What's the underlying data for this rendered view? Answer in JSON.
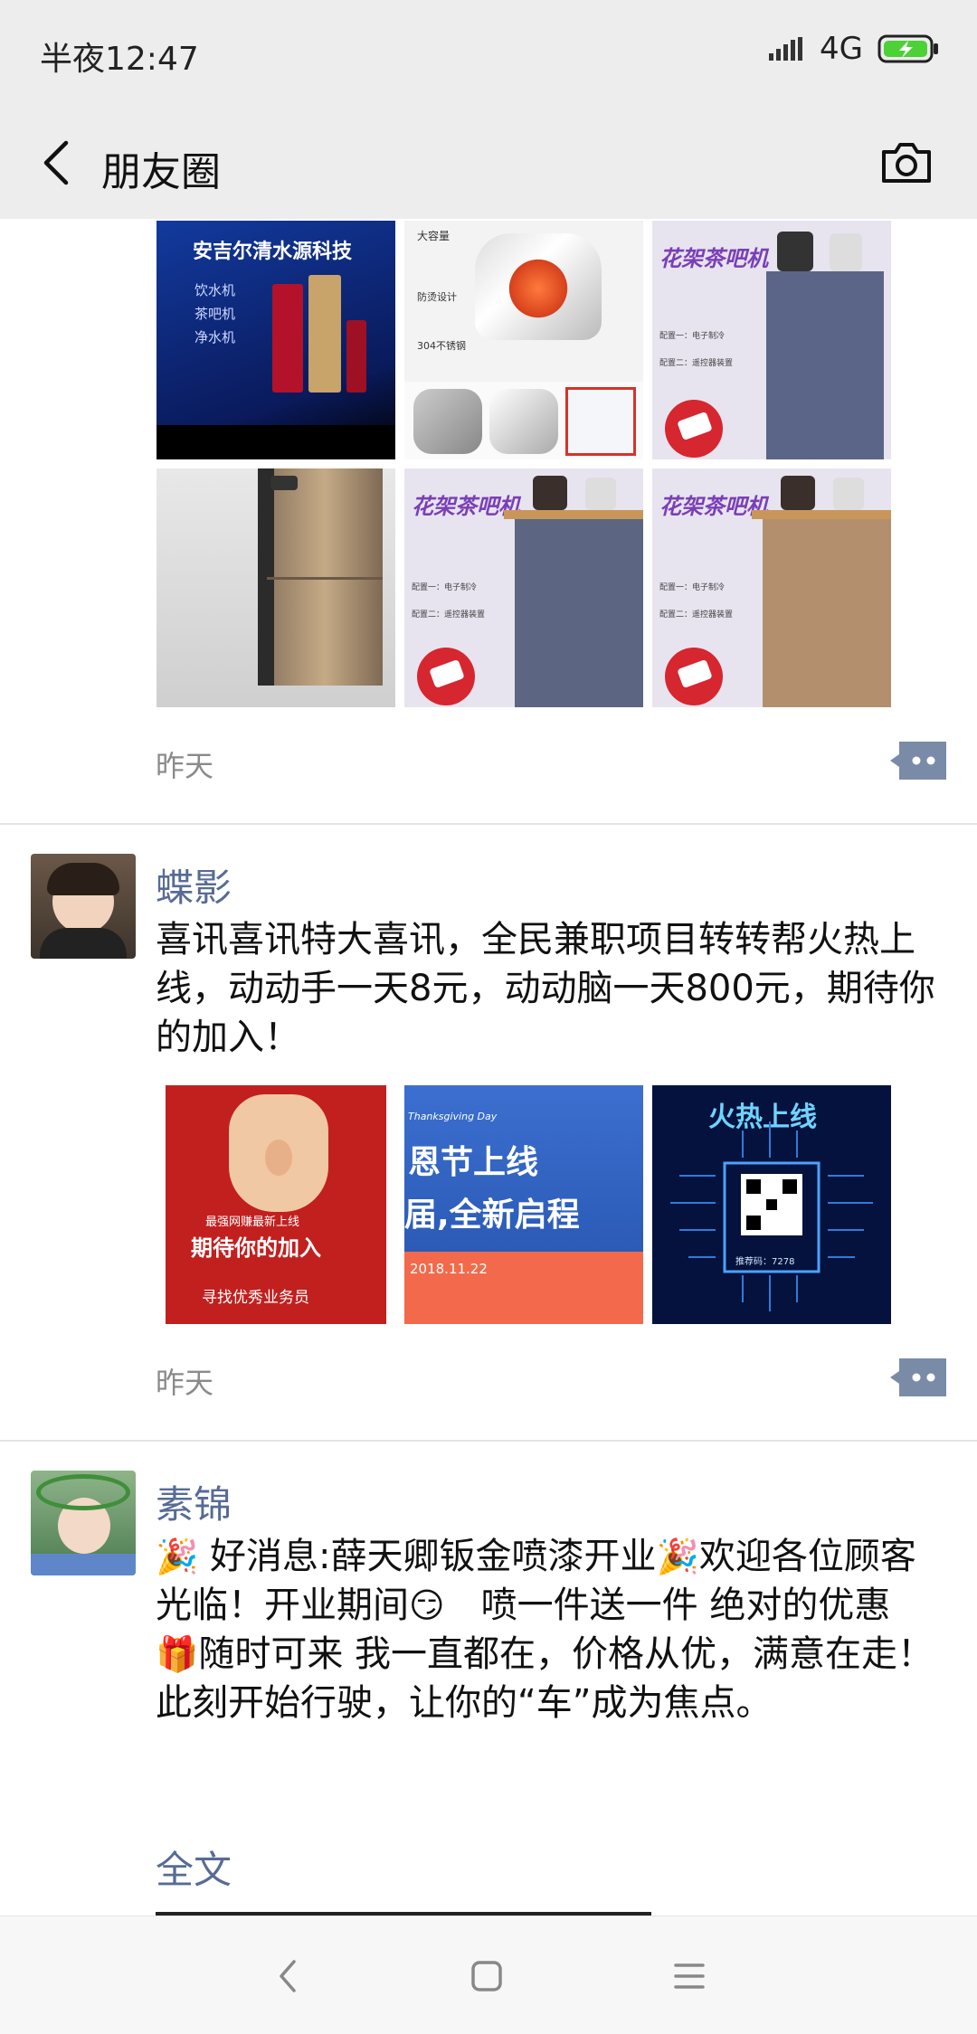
{
  "status_bar": {
    "time": "半夜12:47",
    "network": "4G",
    "icons": [
      "signal-icon",
      "battery-charging-icon"
    ]
  },
  "header": {
    "title": "朋友圈",
    "back_icon": "chevron-left-icon",
    "camera_icon": "camera-icon"
  },
  "posts": [
    {
      "timestamp": "昨天",
      "images": [
        {
          "caption": "安吉尔清水源科技",
          "lines": [
            "饮水机",
            "茶吧机",
            "净水机"
          ]
        },
        {
          "caption": "大容量",
          "lines": [
            "防烫设计",
            "304不锈钢"
          ]
        },
        {
          "caption": "花架茶吧机",
          "lines": [
            "配置一：电子制冷",
            "配置二：遥控器装置"
          ]
        },
        {
          "caption": "",
          "lines": []
        },
        {
          "caption": "花架茶吧机",
          "lines": [
            "配置一：电子制冷",
            "配置二：遥控器装置"
          ]
        },
        {
          "caption": "花架茶吧机",
          "lines": [
            "配置一：电子制冷",
            "配置二：遥控器装置"
          ]
        }
      ]
    },
    {
      "nickname": "蝶影",
      "text": "喜讯喜讯特大喜讯，全民兼职项目转转帮火热上线，动动手一天8元，动动脑一天800元，期待你的加入！",
      "timestamp": "昨天",
      "images": [
        {
          "caption": "期待你的加入",
          "lines": [
            "最强网赚最新上线",
            "寻找优秀业务员"
          ]
        },
        {
          "caption": "恩节上线",
          "lines": [
            "Thanksgiving Day",
            "届,全新启程",
            "2018.11.22"
          ]
        },
        {
          "caption": "火热上线",
          "lines": [
            "推荐码：7278"
          ]
        }
      ]
    },
    {
      "nickname": "素锦",
      "text_parts": [
        "好消息:薛天卿钣金喷漆开业",
        "欢迎各位顾客光临！开业期间",
        "喷一件送一件 绝对的优惠",
        "随时可来 我一直都在，价格从优，满意在走！ 此刻开始行驶，让你的“车”成为焦点。"
      ],
      "emojis": [
        "🎉",
        "🎉",
        "😏",
        "🎁"
      ],
      "fulltext": "全文"
    }
  ],
  "nav_bar": {
    "icons": [
      "back-triangle-icon",
      "home-square-icon",
      "menu-lines-icon"
    ]
  },
  "colors": {
    "link_blue": "#576b95",
    "header_bg": "#ededed",
    "timestamp_gray": "#8a8a8a"
  }
}
